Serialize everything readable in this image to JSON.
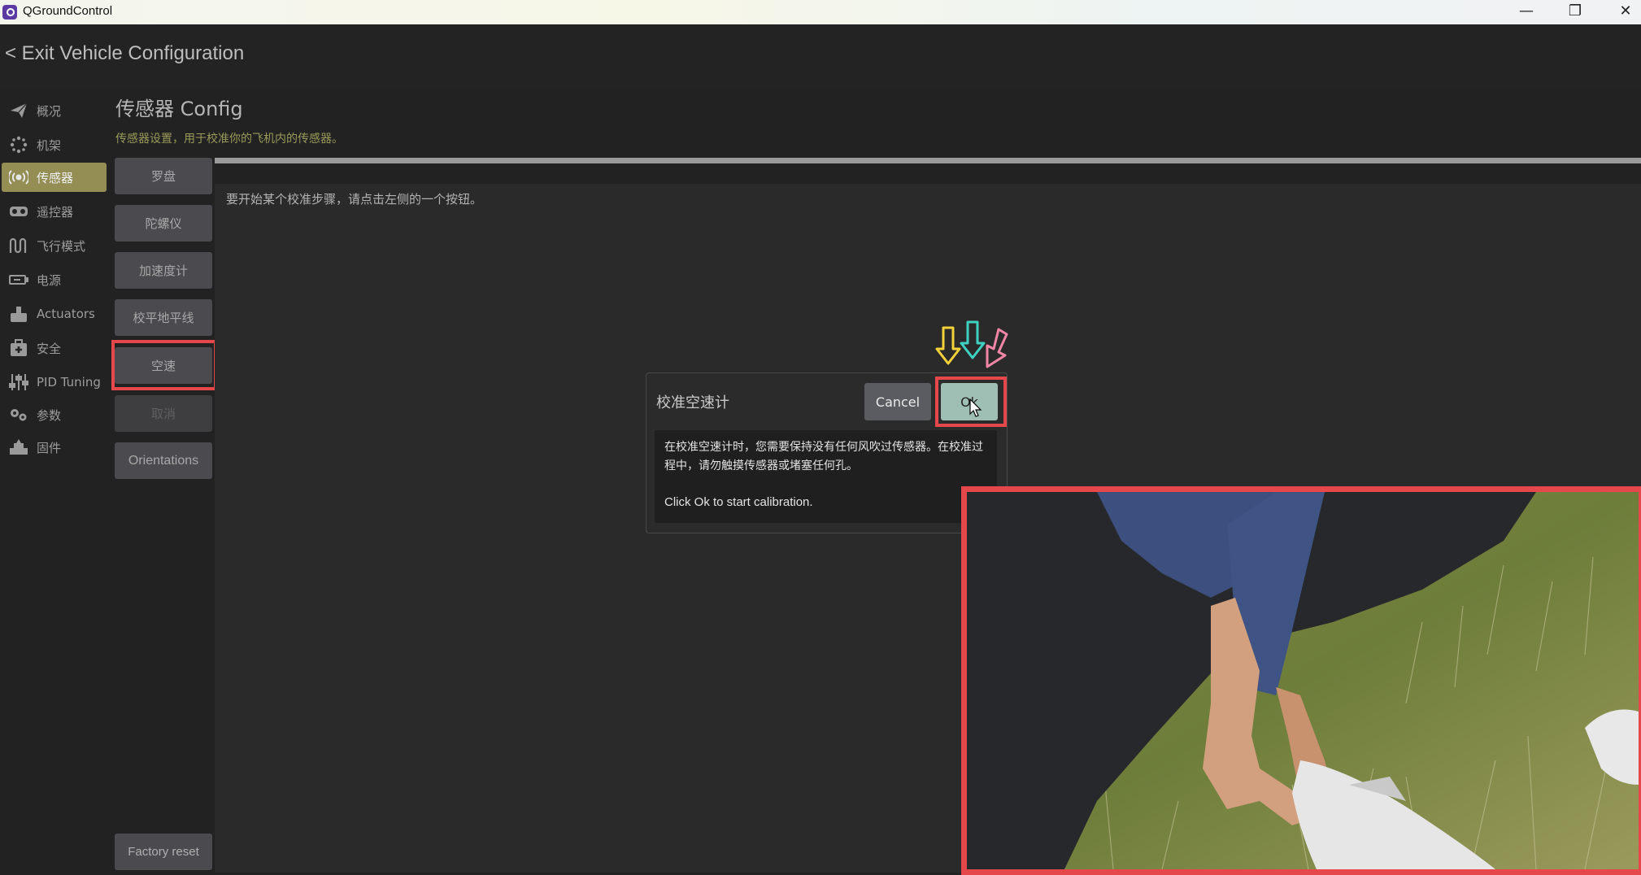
{
  "window": {
    "title": "QGroundControl",
    "controls": [
      "—",
      "❐",
      "✕"
    ]
  },
  "header": {
    "exit_label": "< Exit Vehicle Configuration"
  },
  "sidebar": {
    "items": [
      {
        "label": "概况",
        "icon": "plane-icon"
      },
      {
        "label": "机架",
        "icon": "airframe-icon"
      },
      {
        "label": "传感器",
        "icon": "sensor-icon",
        "active": true
      },
      {
        "label": "遥控器",
        "icon": "radio-icon"
      },
      {
        "label": "飞行模式",
        "icon": "flight-modes-icon"
      },
      {
        "label": "电源",
        "icon": "battery-icon"
      },
      {
        "label": "Actuators",
        "icon": "actuators-icon"
      },
      {
        "label": "安全",
        "icon": "safety-icon"
      },
      {
        "label": "PID Tuning",
        "icon": "tuning-icon"
      },
      {
        "label": "参数",
        "icon": "parameters-icon"
      },
      {
        "label": "固件",
        "icon": "firmware-icon"
      }
    ]
  },
  "page": {
    "title": "传感器 Config",
    "subtitle": "传感器设置，用于校准你的飞机内的传感器。",
    "hint": "要开始某个校准步骤，请点击左侧的一个按钮。"
  },
  "calibration_buttons": [
    {
      "label": "罗盘"
    },
    {
      "label": "陀螺仪"
    },
    {
      "label": "加速度计"
    },
    {
      "label": "校平地平线"
    },
    {
      "label": "空速",
      "highlighted": true
    },
    {
      "label": "取消",
      "disabled": true
    },
    {
      "label": "Orientations"
    }
  ],
  "factory_reset_label": "Factory reset",
  "dialog": {
    "title": "校准空速计",
    "cancel_label": "Cancel",
    "ok_label": "Ok",
    "message_cn": "在校准空速计时，您需要保持没有任何风吹过传感器。在校准过程中，请勿触摸传感器或堵塞任何孔。",
    "message_en": "Click Ok to start calibration."
  },
  "colors": {
    "active_sidebar": "#948e55",
    "highlight_border": "#e6474a",
    "ok_button": "#9fbfb4",
    "arrow_yellow": "#f2d13b",
    "arrow_teal": "#3fd2c3",
    "arrow_pink": "#ef86a6"
  }
}
